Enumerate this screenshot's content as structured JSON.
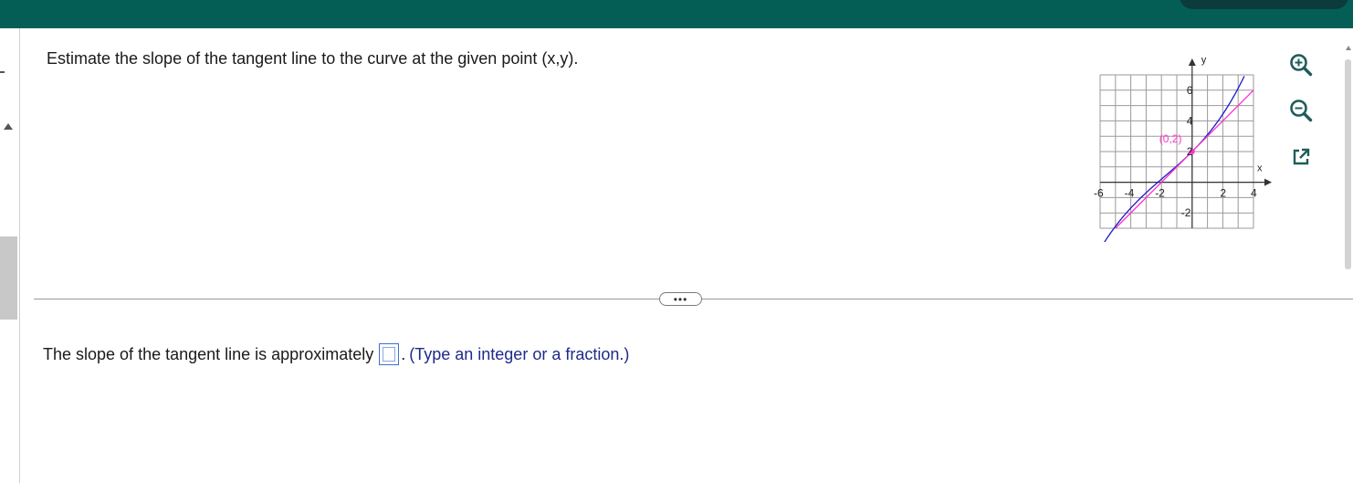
{
  "question": {
    "text": "Estimate the slope of the tangent line to the curve at the given point (x,y)."
  },
  "graph": {
    "x_label": "x",
    "y_label": "y",
    "point_label": "(0,2)",
    "x_tick_labels": [
      "-6",
      "-4",
      "-2",
      "2",
      "4"
    ],
    "y_tick_labels": [
      "6",
      "4",
      "2",
      "-2"
    ],
    "x_range": [
      -6,
      4
    ],
    "y_range": [
      -3,
      7
    ],
    "point": {
      "x": 0,
      "y": 2
    },
    "tangent_line": {
      "slope": 1,
      "intercept": 2
    },
    "curve_color": "#1a1acc",
    "tangent_color": "#ff33cc",
    "point_color": "#ff33cc"
  },
  "toolbar": {
    "zoom_in_icon": "zoom-in-icon",
    "zoom_out_icon": "zoom-out-icon",
    "popout_icon": "popout-icon"
  },
  "divider": {
    "more_label": "•••"
  },
  "answer": {
    "prefix": "The slope of the tangent line is approximately",
    "input_value": "",
    "suffix": ".",
    "hint": "(Type an integer or a fraction.)"
  },
  "colors": {
    "header": "#045e56",
    "accent": "#3d6fd1",
    "hint_text": "#1e2a8a"
  }
}
